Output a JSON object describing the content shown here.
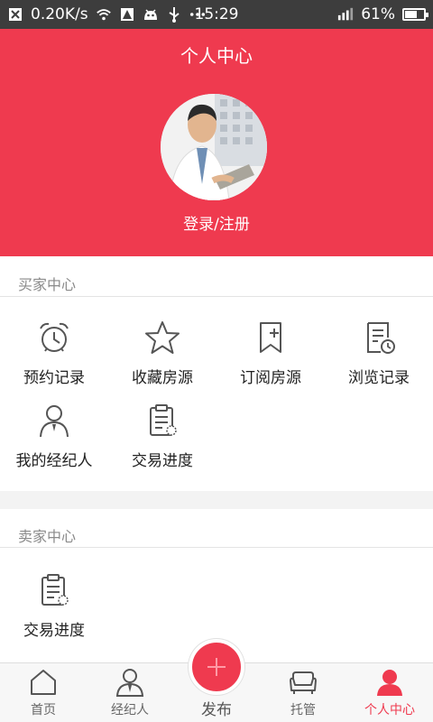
{
  "status_bar": {
    "network_speed": "0.20K/s",
    "time": "15:29",
    "battery": "61%",
    "battery_level": 0.61,
    "icons": [
      "notification-x-icon",
      "wifi-icon",
      "alert-icon",
      "android-icon",
      "usb-icon",
      "more-dots-icon",
      "signal-icon",
      "battery-icon"
    ]
  },
  "header": {
    "title": "个人中心",
    "login_label": "登录/注册"
  },
  "buyer_center": {
    "title": "买家中心",
    "items": [
      {
        "label": "预约记录",
        "icon": "alarm-clock-icon"
      },
      {
        "label": "收藏房源",
        "icon": "star-icon"
      },
      {
        "label": "订阅房源",
        "icon": "bookmark-plus-icon"
      },
      {
        "label": "浏览记录",
        "icon": "history-doc-icon"
      },
      {
        "label": "我的经纪人",
        "icon": "agent-person-icon"
      },
      {
        "label": "交易进度",
        "icon": "clipboard-progress-icon"
      }
    ]
  },
  "seller_center": {
    "title": "卖家中心",
    "items": [
      {
        "label": "交易进度",
        "icon": "clipboard-progress-icon"
      }
    ]
  },
  "bottom_nav": {
    "items": [
      {
        "label": "首页",
        "icon": "home-icon"
      },
      {
        "label": "经纪人",
        "icon": "agent-icon"
      },
      {
        "label": "发布",
        "icon": "plus-icon"
      },
      {
        "label": "托管",
        "icon": "sofa-icon"
      },
      {
        "label": "个人中心",
        "icon": "user-icon"
      }
    ],
    "active": "个人中心"
  },
  "colors": {
    "brand_red": "#ef3a4f",
    "status_bar": "#3d3d3d",
    "icon_gray": "#555555",
    "muted_text": "#8a8a8a"
  }
}
